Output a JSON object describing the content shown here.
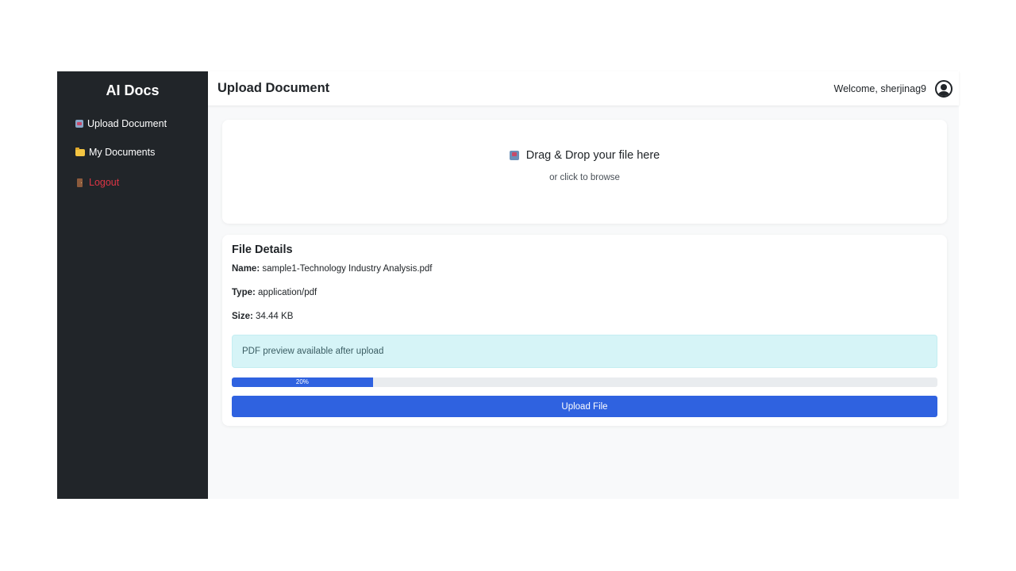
{
  "sidebar": {
    "brand": "AI Docs",
    "items": [
      {
        "label": "Upload Document",
        "icon": "inbox-tray-icon"
      },
      {
        "label": "My Documents",
        "icon": "folder-icon"
      }
    ],
    "logout": {
      "label": "Logout",
      "icon": "door-icon",
      "color": "#dc3545"
    }
  },
  "header": {
    "title": "Upload Document",
    "welcome": "Welcome, sherjinag9",
    "avatar_icon": "user-circle-icon"
  },
  "dropzone": {
    "title": "Drag & Drop your file here",
    "subtitle": "or click to browse",
    "icon": "inbox-tray-icon"
  },
  "file_details": {
    "title": "File Details",
    "name_label": "Name:",
    "name_value": "sample1-Technology Industry Analysis.pdf",
    "type_label": "Type:",
    "type_value": "application/pdf",
    "size_label": "Size:",
    "size_value": "34.44 KB",
    "preview_message": "PDF preview available after upload",
    "progress_label": "20%",
    "progress_percent": 20,
    "upload_button": "Upload File"
  },
  "colors": {
    "sidebar_bg": "#212529",
    "primary": "#2f62e0",
    "alert_bg": "#d6f4f7",
    "logout": "#dc3545"
  }
}
